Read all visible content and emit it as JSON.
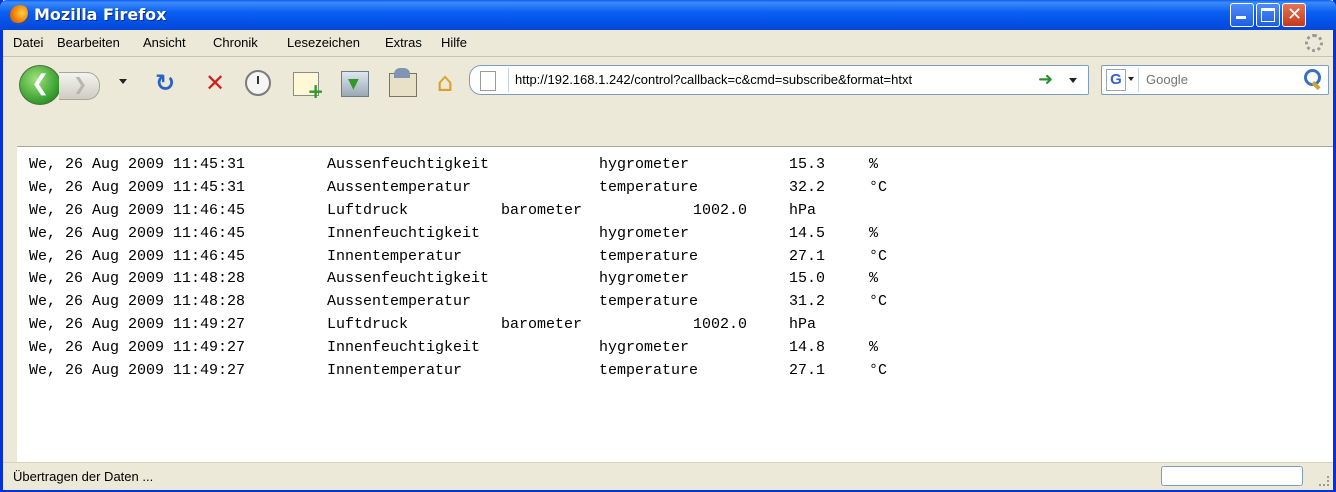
{
  "window": {
    "title": "Mozilla Firefox"
  },
  "menu": [
    "Datei",
    "Bearbeiten",
    "Ansicht",
    "Chronik",
    "Lesezeichen",
    "Extras",
    "Hilfe"
  ],
  "navigation": {
    "url": "http://192.168.1.242/control?callback=c&cmd=subscribe&format=htxt",
    "search_engine": "G",
    "search_placeholder": "Google"
  },
  "log": [
    {
      "date": "We, 26 Aug 2009 11:45:31",
      "name": "Aussenfeuchtigkeit",
      "type": "hygrometer",
      "value": "15.3",
      "unit": "%"
    },
    {
      "date": "We, 26 Aug 2009 11:45:31",
      "name": "Aussentemperatur",
      "type": "temperature",
      "value": "32.2",
      "unit": "°C"
    },
    {
      "date": "We, 26 Aug 2009 11:46:45",
      "name": "Luftdruck",
      "type": "barometer",
      "value": "1002.0",
      "unit": "hPa"
    },
    {
      "date": "We, 26 Aug 2009 11:46:45",
      "name": "Innenfeuchtigkeit",
      "type": "hygrometer",
      "value": "14.5",
      "unit": "%"
    },
    {
      "date": "We, 26 Aug 2009 11:46:45",
      "name": "Innentemperatur",
      "type": "temperature",
      "value": "27.1",
      "unit": "°C"
    },
    {
      "date": "We, 26 Aug 2009 11:48:28",
      "name": "Aussenfeuchtigkeit",
      "type": "hygrometer",
      "value": "15.0",
      "unit": "%"
    },
    {
      "date": "We, 26 Aug 2009 11:48:28",
      "name": "Aussentemperatur",
      "type": "temperature",
      "value": "31.2",
      "unit": "°C"
    },
    {
      "date": "We, 26 Aug 2009 11:49:27",
      "name": "Luftdruck",
      "type": "barometer",
      "value": "1002.0",
      "unit": "hPa"
    },
    {
      "date": "We, 26 Aug 2009 11:49:27",
      "name": "Innenfeuchtigkeit",
      "type": "hygrometer",
      "value": "14.8",
      "unit": "%"
    },
    {
      "date": "We, 26 Aug 2009 11:49:27",
      "name": "Innentemperatur",
      "type": "temperature",
      "value": "27.1",
      "unit": "°C"
    }
  ],
  "status": {
    "text": "Übertragen der Daten ..."
  },
  "colors": {
    "titlebar": "#0553e8",
    "accent_green": "#2e8f2e",
    "stop_red": "#d22020"
  },
  "icons": [
    "firefox-icon",
    "back-icon",
    "forward-icon",
    "reload-icon",
    "stop-icon",
    "history-icon",
    "new-tab-icon",
    "download-icon",
    "mail-icon",
    "home-icon",
    "page-icon",
    "go-arrow-icon",
    "search-icon"
  ]
}
